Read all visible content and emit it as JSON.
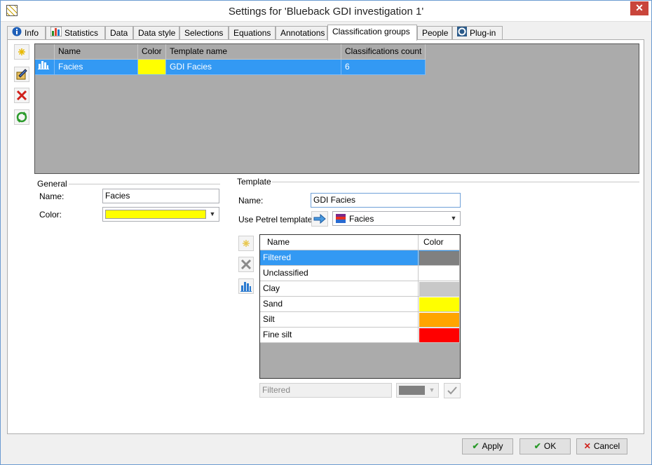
{
  "window": {
    "title": "Settings for 'Blueback GDI investigation 1'",
    "close_glyph": "✕"
  },
  "tabs": [
    {
      "label": "Info",
      "icon": "info-icon"
    },
    {
      "label": "Statistics",
      "icon": "statistics-icon"
    },
    {
      "label": "Data"
    },
    {
      "label": "Data style"
    },
    {
      "label": "Selections"
    },
    {
      "label": "Equations"
    },
    {
      "label": "Annotations"
    },
    {
      "label": "Classification groups",
      "active": true
    },
    {
      "label": "People"
    },
    {
      "label": "Plug-in",
      "icon": "plugin-icon"
    }
  ],
  "groups_grid": {
    "columns": [
      "Name",
      "Color",
      "Template name",
      "Classifications count"
    ],
    "rows": [
      {
        "name": "Facies",
        "color": "#ffff00",
        "template": "GDI Facies",
        "count": "6",
        "selected": true
      }
    ]
  },
  "general": {
    "title": "General",
    "name_label": "Name:",
    "name_value": "Facies",
    "color_label": "Color:",
    "color_value": "#ffff00"
  },
  "template": {
    "title": "Template",
    "name_label": "Name:",
    "name_value": "GDI Facies",
    "petrel_label": "Use Petrel template:",
    "petrel_value": "Facies",
    "table_columns": [
      "Name",
      "Color"
    ],
    "rows": [
      {
        "name": "Filtered",
        "color": "#808080",
        "selected": true
      },
      {
        "name": "Unclassified",
        "color": "#ffffff"
      },
      {
        "name": "Clay",
        "color": "#c8c8c8"
      },
      {
        "name": "Sand",
        "color": "#ffff00"
      },
      {
        "name": "Silt",
        "color": "#ffa500"
      },
      {
        "name": "Fine silt",
        "color": "#ff0000"
      }
    ],
    "edit_name_value": "Filtered",
    "edit_color_value": "#808080"
  },
  "buttons": {
    "apply": "Apply",
    "ok": "OK",
    "cancel": "Cancel"
  }
}
